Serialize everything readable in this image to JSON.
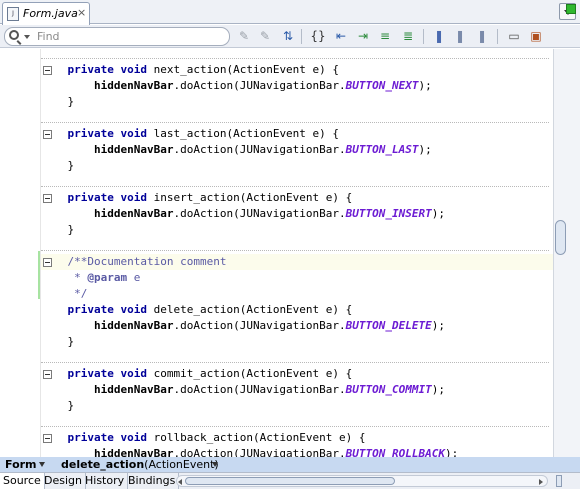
{
  "editor_tab": {
    "title": "Form.java",
    "close": "×",
    "file_icon_text": "J"
  },
  "search": {
    "placeholder": "Find"
  },
  "toolbar": {
    "buttons": [
      {
        "name": "prev-occurrence-icon",
        "glyph": "✎",
        "color": "#9aa0a8"
      },
      {
        "name": "next-occurrence-icon",
        "glyph": "✎",
        "color": "#9aa0a8"
      },
      {
        "name": "toggle-highlight-icon",
        "glyph": "⇅",
        "color": "#2a5aa8"
      },
      {
        "name": "match-brace-icon",
        "glyph": "{}",
        "color": "#333333"
      },
      {
        "name": "shift-left-icon",
        "glyph": "⇤",
        "color": "#2a5aa8"
      },
      {
        "name": "shift-right-icon",
        "glyph": "⇥",
        "color": "#2a8a3a"
      },
      {
        "name": "comment-icon",
        "glyph": "≡",
        "color": "#2a8a3a"
      },
      {
        "name": "uncomment-icon",
        "glyph": "≣",
        "color": "#2a8a3a"
      },
      {
        "name": "bookmark-icon",
        "glyph": "❚",
        "color": "#4a6ab0"
      },
      {
        "name": "prev-bookmark-icon",
        "glyph": "❚",
        "color": "#7a8aaa"
      },
      {
        "name": "next-bookmark-icon",
        "glyph": "❚",
        "color": "#7a8aaa"
      },
      {
        "name": "start-macro-icon",
        "glyph": "▭",
        "color": "#555555"
      },
      {
        "name": "stop-macro-icon",
        "glyph": "▣",
        "color": "#b05020"
      }
    ]
  },
  "code": {
    "methods": [
      {
        "sig": "next_action(ActionEvent e) {",
        "call_prefix": "hiddenNavBar",
        "call_mid": ".doAction(JUNavigationBar.",
        "const": "BUTTON_NEXT",
        "tail": ");"
      },
      {
        "sig": "last_action(ActionEvent e) {",
        "call_prefix": "hiddenNavBar",
        "call_mid": ".doAction(JUNavigationBar.",
        "const": "BUTTON_LAST",
        "tail": ");"
      },
      {
        "sig": "insert_action(ActionEvent e) {",
        "call_prefix": "hiddenNavBar",
        "call_mid": ".doAction(JUNavigationBar.",
        "const": "BUTTON_INSERT",
        "tail": ");"
      },
      {
        "sig": "delete_action(ActionEvent e) {",
        "call_prefix": "hiddenNavBar",
        "call_mid": ".doAction(JUNavigationBar.",
        "const": "BUTTON_DELETE",
        "tail": ");"
      },
      {
        "sig": "commit_action(ActionEvent e) {",
        "call_prefix": "hiddenNavBar",
        "call_mid": ".doAction(JUNavigationBar.",
        "const": "BUTTON_COMMIT",
        "tail": ");"
      },
      {
        "sig": "rollback_action(ActionEvent e) {",
        "call_prefix": "hiddenNavBar",
        "call_mid": ".doAction(JUNavigationBar.",
        "const": "BUTTON_ROLLBACK",
        "tail": ");"
      }
    ],
    "keyword_private": "private",
    "keyword_void": "void",
    "close_brace": "}",
    "doc": {
      "line1": "/**Documentation comment",
      "line2_star": " * ",
      "line2_tag": "@param",
      "line2_rest": " e",
      "line3": " */"
    }
  },
  "breadcrumb": {
    "root": "Form",
    "method_name": "delete_action",
    "method_params": "(ActionEvent)"
  },
  "bottom_tabs": [
    "Source",
    "Design",
    "History",
    "Bindings"
  ],
  "colors": {
    "keyword": "#000099",
    "constant": "#6c1bd3",
    "comment": "#5a5aa4",
    "status_ok": "#2fb82f",
    "breadcrumb_bg": "#c7d9f1"
  }
}
